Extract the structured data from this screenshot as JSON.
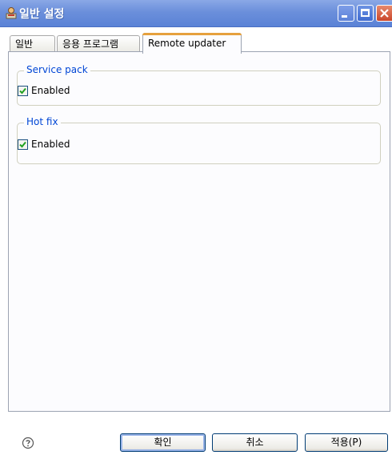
{
  "window": {
    "title": "일반 설정",
    "icons": [
      "app-icon",
      "minimize-icon",
      "maximize-icon",
      "close-icon"
    ]
  },
  "tabs": [
    {
      "label": "일반",
      "active": false
    },
    {
      "label": "응용 프로그램",
      "active": false
    },
    {
      "label": "Remote updater",
      "active": true
    }
  ],
  "groups": {
    "service_pack": {
      "title": "Service pack",
      "checkbox_label": "Enabled",
      "checked": true
    },
    "hot_fix": {
      "title": "Hot fix",
      "checkbox_label": "Enabled",
      "checked": true
    }
  },
  "footer": {
    "help_icon": "question-icon",
    "ok_label": "확인",
    "cancel_label": "취소",
    "apply_label": "적용(P)"
  },
  "colors": {
    "titlebar": "#6b8fdb",
    "group_title": "#0046d5",
    "active_tab_accent": "#e6a13d",
    "close_button": "#c9452a"
  }
}
